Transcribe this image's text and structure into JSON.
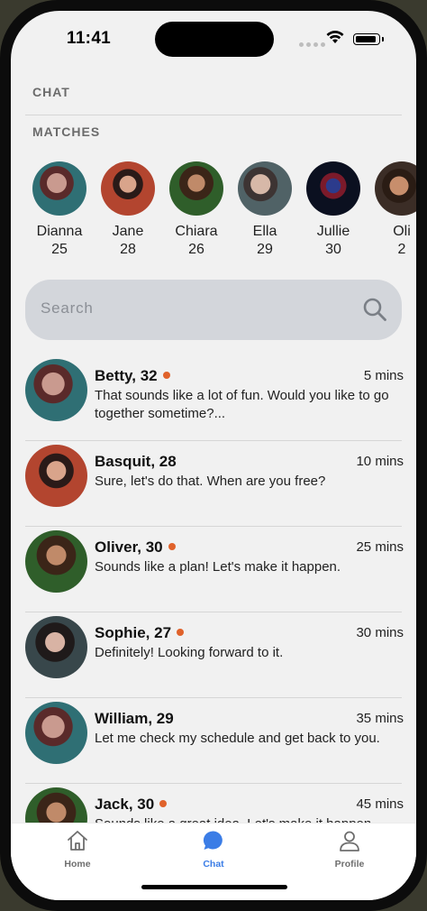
{
  "status_bar": {
    "time": "11:41"
  },
  "header": {
    "title": "CHAT"
  },
  "matches": {
    "title": "MATCHES",
    "items": [
      {
        "name": "Dianna",
        "age": "25"
      },
      {
        "name": "Jane",
        "age": "28"
      },
      {
        "name": "Chiara",
        "age": "26"
      },
      {
        "name": "Ella",
        "age": "29"
      },
      {
        "name": "Jullie",
        "age": "30"
      },
      {
        "name": "Oli",
        "age": "2"
      }
    ]
  },
  "search": {
    "placeholder": "Search"
  },
  "chats": [
    {
      "name": "Betty, 32",
      "online": true,
      "time": "5 mins",
      "message": "That sounds like a lot of fun. Would you like to go together sometime?..."
    },
    {
      "name": "Basquit, 28",
      "online": false,
      "time": "10 mins",
      "message": "Sure, let's do that. When are you free?"
    },
    {
      "name": "Oliver, 30",
      "online": true,
      "time": "25 mins",
      "message": "Sounds like a plan! Let's make it happen."
    },
    {
      "name": "Sophie, 27",
      "online": true,
      "time": "30 mins",
      "message": "Definitely! Looking forward to it."
    },
    {
      "name": "William, 29",
      "online": false,
      "time": "35 mins",
      "message": "Let me check my schedule and get back to you."
    },
    {
      "name": "Jack, 30",
      "online": true,
      "time": "45 mins",
      "message": "Sounds like a great idea. Let's make it happen."
    }
  ],
  "tab_bar": {
    "tabs": [
      {
        "label": "Home",
        "icon": "home-icon",
        "active": false
      },
      {
        "label": "Chat",
        "icon": "chat-bubble-icon",
        "active": true
      },
      {
        "label": "Profile",
        "icon": "person-icon",
        "active": false
      }
    ]
  },
  "colors": {
    "accent": "#3b7de6",
    "online_dot": "#e0622b",
    "search_bg": "#d3d6db",
    "screen_bg": "#f1f1f1"
  }
}
